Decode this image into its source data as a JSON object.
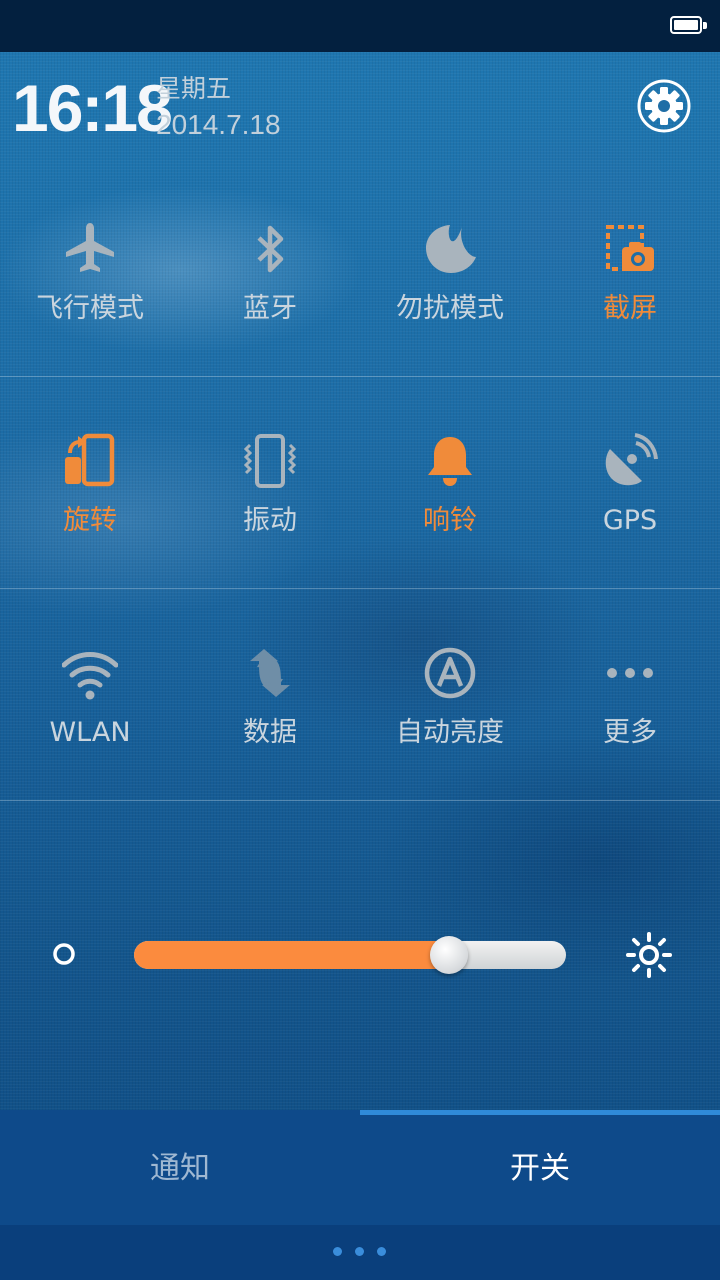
{
  "status_bar": {
    "battery_icon": "battery-full-icon"
  },
  "header": {
    "time": "16:18",
    "weekday": "星期五",
    "date": "2014.7.18",
    "settings_icon": "gear-icon"
  },
  "toggles": [
    {
      "label": "飞行模式",
      "icon": "airplane-icon",
      "state": "off"
    },
    {
      "label": "蓝牙",
      "icon": "bluetooth-icon",
      "state": "off"
    },
    {
      "label": "勿扰模式",
      "icon": "moon-icon",
      "state": "off"
    },
    {
      "label": "截屏",
      "icon": "screenshot-icon",
      "state": "on"
    },
    {
      "label": "旋转",
      "icon": "rotate-icon",
      "state": "on"
    },
    {
      "label": "振动",
      "icon": "vibrate-icon",
      "state": "off"
    },
    {
      "label": "响铃",
      "icon": "bell-icon",
      "state": "on"
    },
    {
      "label": "GPS",
      "icon": "gps-icon",
      "state": "off"
    },
    {
      "label": "WLAN",
      "icon": "wifi-icon",
      "state": "off"
    },
    {
      "label": "数据",
      "icon": "data-icon",
      "state": "off"
    },
    {
      "label": "自动亮度",
      "icon": "auto-brightness-icon",
      "state": "off"
    },
    {
      "label": "更多",
      "icon": "more-icon",
      "state": "off"
    }
  ],
  "brightness": {
    "level": 0.73,
    "low_icon": "brightness-low-icon",
    "high_icon": "brightness-high-icon"
  },
  "tabs": [
    {
      "label": "通知",
      "active": false
    },
    {
      "label": "开关",
      "active": true
    }
  ],
  "pager": {
    "pages": 3
  },
  "colors": {
    "accent": "#fb8b3e",
    "inactive_icon": "#a9b4bd",
    "tab_indicator": "#2f8ad8"
  }
}
